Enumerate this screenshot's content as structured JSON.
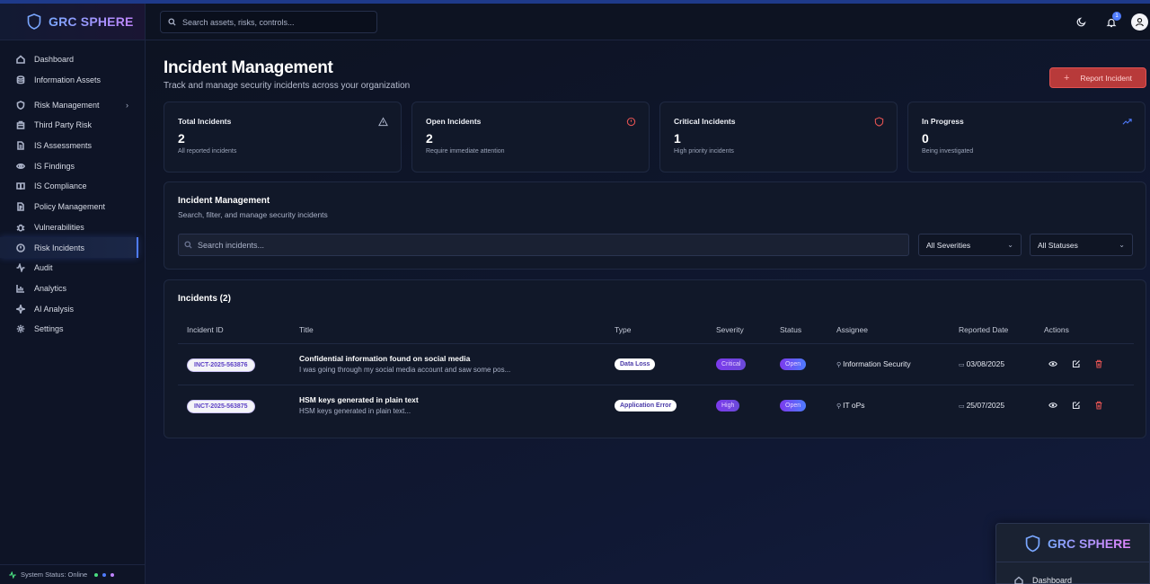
{
  "app": {
    "brand": "GRC SPHERE"
  },
  "header": {
    "search_placeholder": "Search assets, risks, controls...",
    "notification_count": "1"
  },
  "sidebar": {
    "items": [
      {
        "label": "Dashboard",
        "icon": "home-icon"
      },
      {
        "label": "Information Assets",
        "icon": "database-icon"
      },
      {
        "label": "Risk Management",
        "icon": "shield-icon"
      },
      {
        "label": "Third Party Risk",
        "icon": "building-icon"
      },
      {
        "label": "IS Assessments",
        "icon": "file-icon"
      },
      {
        "label": "IS Findings",
        "icon": "eye-icon"
      },
      {
        "label": "IS Compliance",
        "icon": "book-icon"
      },
      {
        "label": "Policy Management",
        "icon": "document-icon"
      },
      {
        "label": "Vulnerabilities",
        "icon": "bug-icon"
      },
      {
        "label": "Risk Incidents",
        "icon": "alert-circle-icon"
      },
      {
        "label": "Audit",
        "icon": "activity-icon"
      },
      {
        "label": "Analytics",
        "icon": "bar-chart-icon"
      },
      {
        "label": "AI Analysis",
        "icon": "sparkle-icon"
      },
      {
        "label": "Settings",
        "icon": "gear-icon"
      }
    ],
    "status": "System Status: Online"
  },
  "page": {
    "title": "Incident Management",
    "subtitle": "Track and manage security incidents across your organization",
    "report_button": "Report Incident"
  },
  "cards": [
    {
      "label": "Total Incidents",
      "value": "2",
      "note": "All reported incidents",
      "color": "#aab2c8"
    },
    {
      "label": "Open Incidents",
      "value": "2",
      "note": "Require immediate attention",
      "color": "#e05252"
    },
    {
      "label": "Critical Incidents",
      "value": "1",
      "note": "High priority incidents",
      "color": "#e05252"
    },
    {
      "label": "In Progress",
      "value": "0",
      "note": "Being investigated",
      "color": "#4f7cff"
    }
  ],
  "filters": {
    "title": "Incident Management",
    "subtitle": "Search, filter, and manage security incidents",
    "search_placeholder": "Search incidents...",
    "severity": "All Severities",
    "status": "All Statuses"
  },
  "table": {
    "title": "Incidents (2)",
    "columns": [
      "Incident ID",
      "Title",
      "Type",
      "Severity",
      "Status",
      "Assignee",
      "Reported Date",
      "Actions"
    ],
    "rows": [
      {
        "id": "INCT-2025-563876",
        "title": "Confidential information found on social media",
        "desc": "I was going through my social media account and saw some pos...",
        "type": "Data Loss",
        "severity": "Critical",
        "status": "Open",
        "assignee": "Information Security",
        "date": "03/08/2025"
      },
      {
        "id": "INCT-2025-563875",
        "title": "HSM keys generated in plain text",
        "desc": "HSM keys generated in plain text...",
        "type": "Application Error",
        "severity": "High",
        "status": "Open",
        "assignee": "IT oPs",
        "date": "25/07/2025"
      }
    ]
  },
  "preview": {
    "brand": "GRC SPHERE",
    "item": "Dashboard"
  }
}
